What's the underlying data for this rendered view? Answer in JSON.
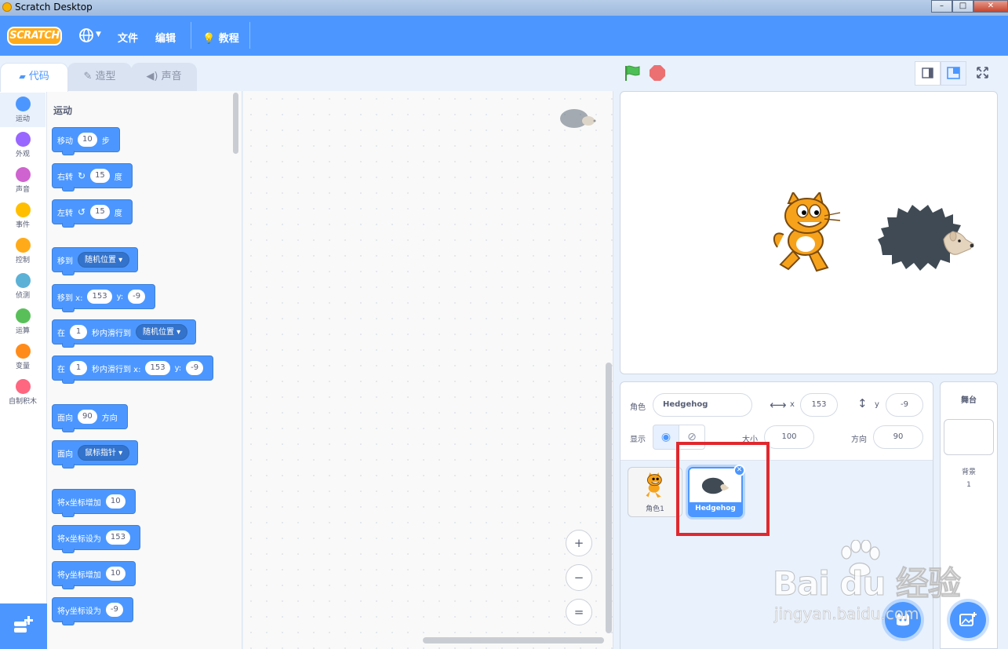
{
  "window": {
    "title": "Scratch Desktop"
  },
  "menubar": {
    "logo": "SCRATCH",
    "file": "文件",
    "edit": "编辑",
    "tutorials": "教程"
  },
  "tabs": {
    "code": "代码",
    "costumes": "造型",
    "sounds": "声音"
  },
  "categories": [
    {
      "label": "运动",
      "color": "#4c97ff"
    },
    {
      "label": "外观",
      "color": "#9966ff"
    },
    {
      "label": "声音",
      "color": "#cf63cf"
    },
    {
      "label": "事件",
      "color": "#ffbf00"
    },
    {
      "label": "控制",
      "color": "#ffab19"
    },
    {
      "label": "侦测",
      "color": "#5cb1d6"
    },
    {
      "label": "运算",
      "color": "#59c059"
    },
    {
      "label": "变量",
      "color": "#ff8c1a"
    },
    {
      "label": "自制积木",
      "color": "#ff6680"
    }
  ],
  "palette": {
    "section": "运动",
    "move": {
      "a": "移动",
      "n": "10",
      "b": "步"
    },
    "turn_right": {
      "a": "右转",
      "n": "15",
      "b": "度"
    },
    "turn_left": {
      "a": "左转",
      "n": "15",
      "b": "度"
    },
    "goto": {
      "a": "移到",
      "opt": "随机位置"
    },
    "goto_xy": {
      "a": "移到 x:",
      "x": "153",
      "b": "y:",
      "y": "-9"
    },
    "glide": {
      "a": "在",
      "n": "1",
      "b": "秒内滑行到",
      "opt": "随机位置"
    },
    "glide_xy": {
      "a": "在",
      "n": "1",
      "b": "秒内滑行到 x:",
      "x": "153",
      "c": "y:",
      "y": "-9"
    },
    "point_dir": {
      "a": "面向",
      "n": "90",
      "b": "方向"
    },
    "point_towards": {
      "a": "面向",
      "opt": "鼠标指针"
    },
    "change_x": {
      "a": "将x坐标增加",
      "n": "10"
    },
    "set_x": {
      "a": "将x坐标设为",
      "n": "153"
    },
    "change_y": {
      "a": "将y坐标增加",
      "n": "10"
    },
    "set_y": {
      "a": "将y坐标设为",
      "n": "-9"
    }
  },
  "zoom": {
    "in": "+",
    "out": "−",
    "reset": "="
  },
  "sprite_info": {
    "sprite_label": "角色",
    "sprite_name": "Hedgehog",
    "x_label": "x",
    "x": "153",
    "y_label": "y",
    "y": "-9",
    "show_label": "显示",
    "size_label": "大小",
    "size": "100",
    "direction_label": "方向",
    "direction": "90"
  },
  "sprites": [
    {
      "name": "角色1"
    },
    {
      "name": "Hedgehog"
    }
  ],
  "stage_panel": {
    "title": "舞台",
    "backdrops_label": "背景",
    "backdrops_count": "1"
  },
  "watermark": {
    "main": "Bai du 经验",
    "sub": "jingyan.baidu.com"
  }
}
